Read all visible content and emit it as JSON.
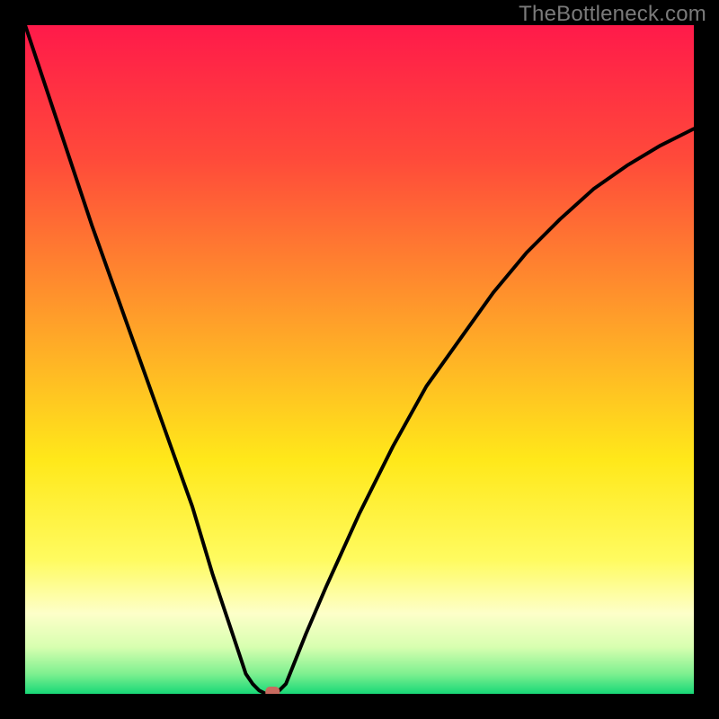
{
  "watermark": "TheBottleneck.com",
  "chart_data": {
    "type": "line",
    "title": "",
    "xlabel": "",
    "ylabel": "",
    "xlim": [
      0,
      100
    ],
    "ylim": [
      0,
      100
    ],
    "grid": false,
    "background": "rainbow-gradient",
    "series": [
      {
        "name": "bottleneck-curve",
        "x": [
          0,
          5,
          10,
          15,
          20,
          25,
          28,
          30,
          32,
          33,
          34,
          35,
          36,
          37,
          38,
          39,
          40,
          42,
          45,
          50,
          55,
          60,
          65,
          70,
          75,
          80,
          85,
          90,
          95,
          100
        ],
        "values": [
          100,
          85,
          70,
          56,
          42,
          28,
          18,
          12,
          6,
          3,
          1.5,
          0.5,
          0,
          0,
          0.5,
          1.5,
          4,
          9,
          16,
          27,
          37,
          46,
          53,
          60,
          66,
          71,
          75.5,
          79,
          82,
          84.5
        ],
        "color": "#000000"
      }
    ],
    "marker": {
      "name": "optimal-point",
      "x": 37,
      "y": 0,
      "color": "#c86a5f"
    },
    "gradient_stops": [
      {
        "offset": 0,
        "color": "#ff1a4a"
      },
      {
        "offset": 20,
        "color": "#ff4a3a"
      },
      {
        "offset": 45,
        "color": "#ffa229"
      },
      {
        "offset": 65,
        "color": "#ffe81a"
      },
      {
        "offset": 80,
        "color": "#fffb60"
      },
      {
        "offset": 88,
        "color": "#fdffc9"
      },
      {
        "offset": 93,
        "color": "#d8ffb0"
      },
      {
        "offset": 97,
        "color": "#7ef090"
      },
      {
        "offset": 100,
        "color": "#18d877"
      }
    ]
  }
}
